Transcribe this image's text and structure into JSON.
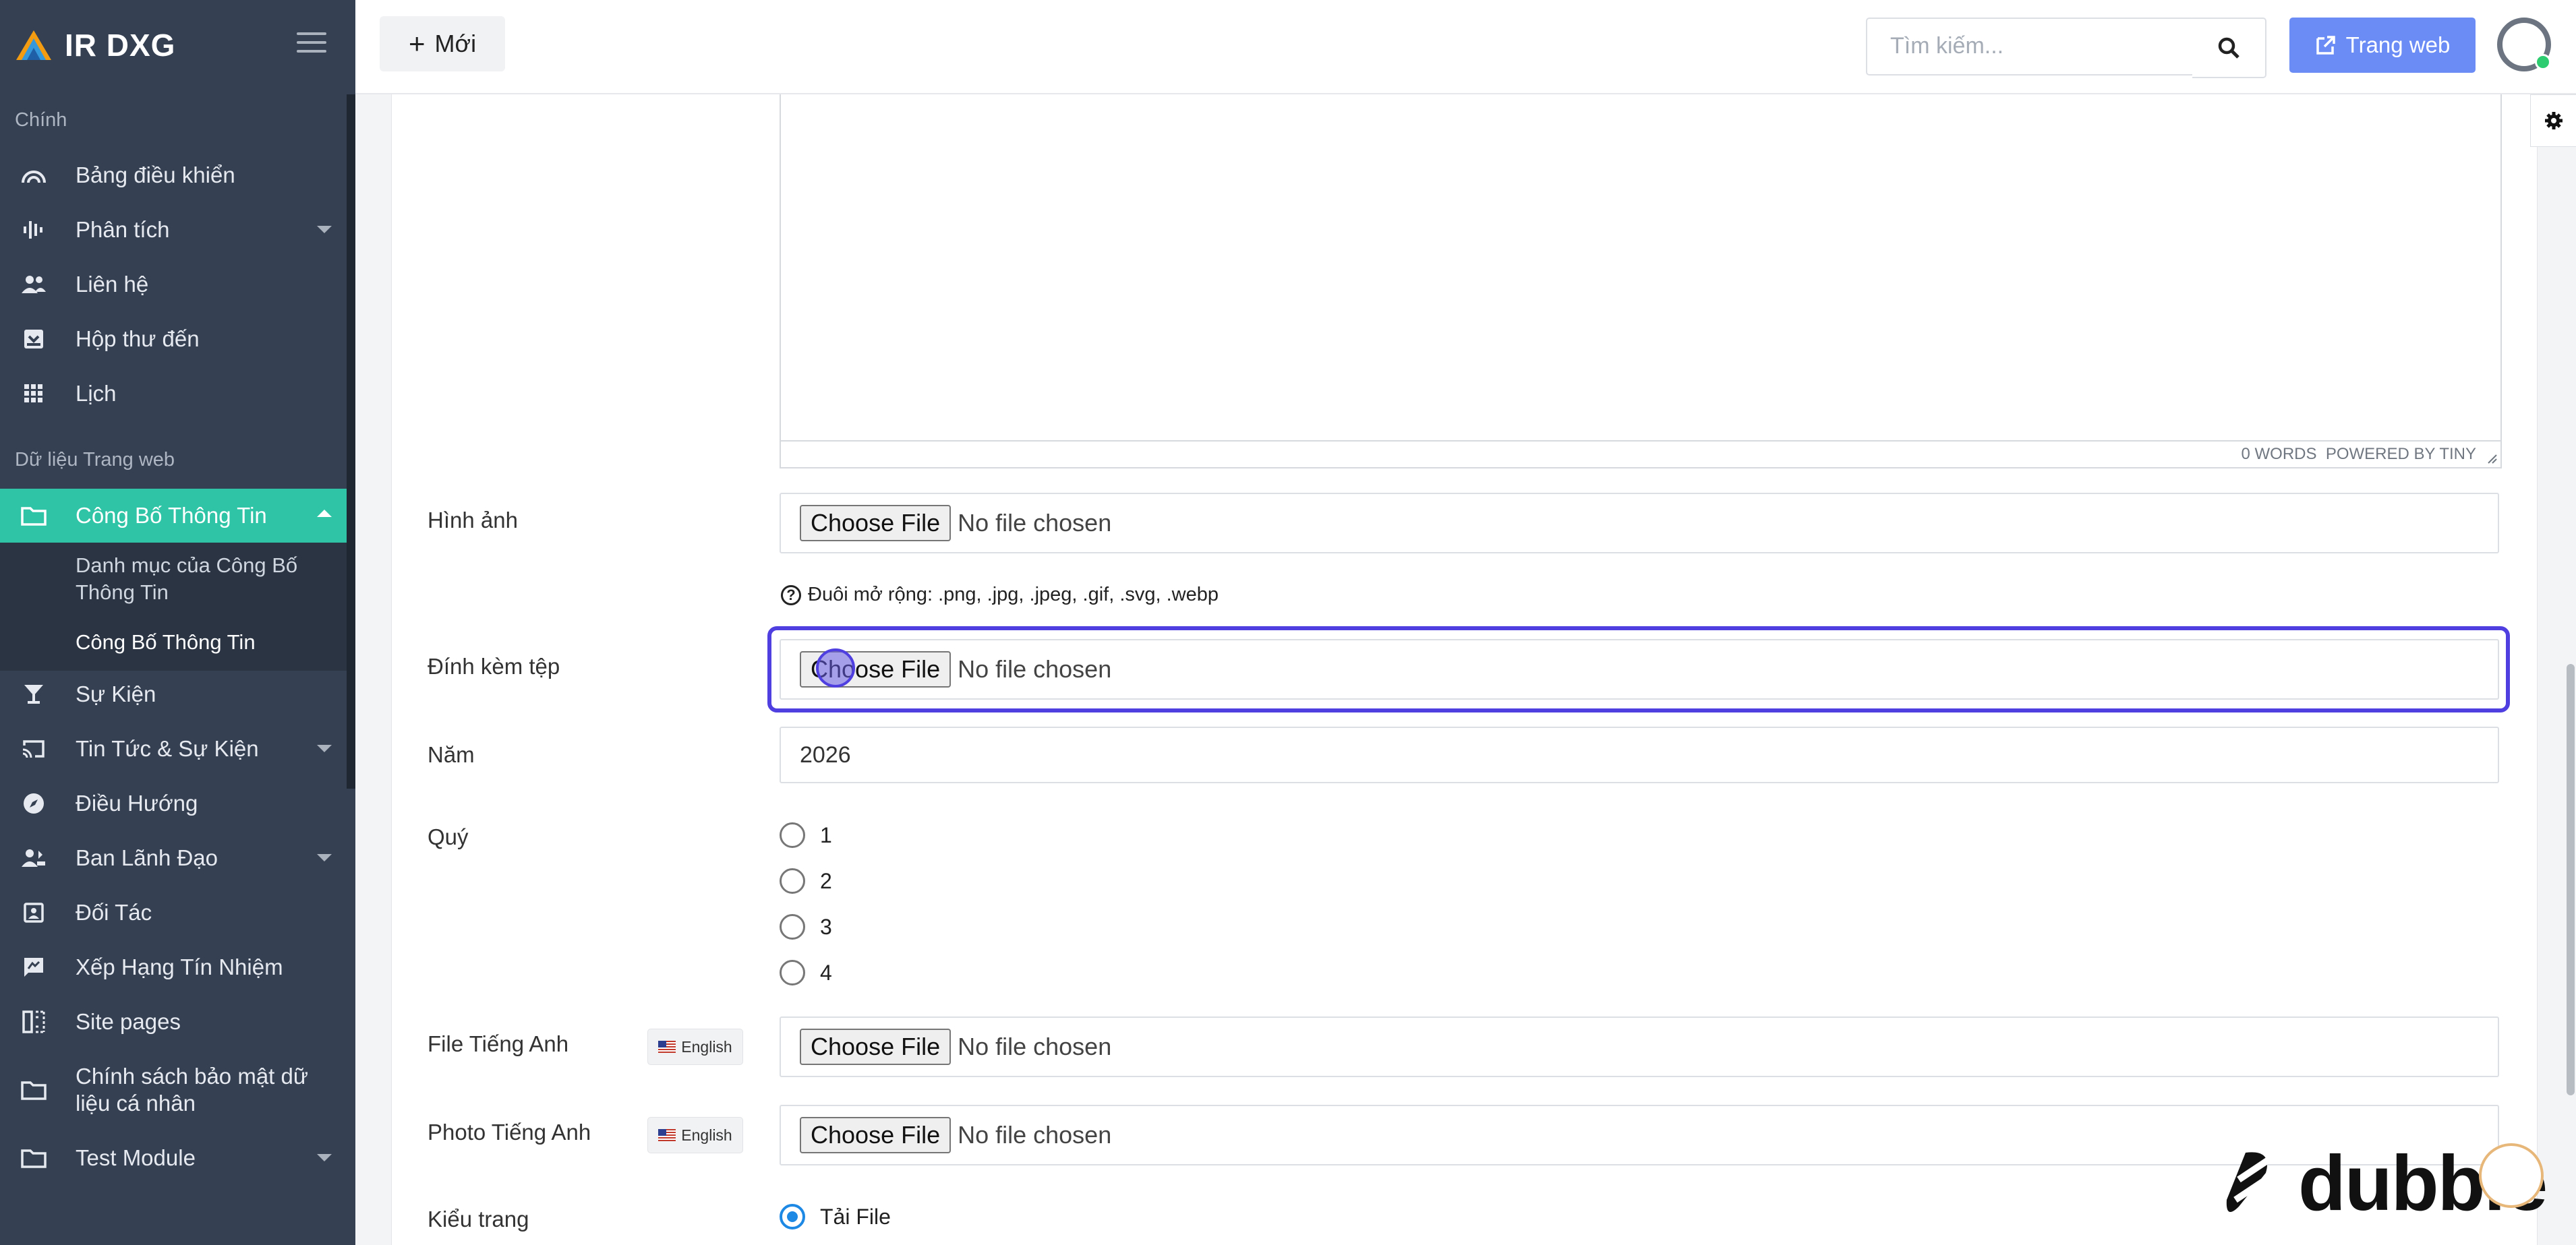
{
  "app": {
    "brand": "IR DXG"
  },
  "sidebar": {
    "section_main": "Chính",
    "section_web": "Dữ liệu Trang web",
    "items": [
      {
        "label": "Bảng điều khiển",
        "icon": "dashboard-icon"
      },
      {
        "label": "Phân tích",
        "icon": "analytics-icon"
      },
      {
        "label": "Liên hệ",
        "icon": "contacts-icon"
      },
      {
        "label": "Hộp thư đến",
        "icon": "inbox-icon"
      },
      {
        "label": "Lịch",
        "icon": "calendar-grid-icon"
      },
      {
        "label": "Công Bố Thông Tin",
        "icon": "folder-icon"
      },
      {
        "label": "Sự Kiện",
        "icon": "glass-icon"
      },
      {
        "label": "Tin Tức & Sự Kiện",
        "icon": "cast-icon"
      },
      {
        "label": "Điều Hướng",
        "icon": "compass-icon"
      },
      {
        "label": "Ban Lãnh Đạo",
        "icon": "people-icon"
      },
      {
        "label": "Đối Tác",
        "icon": "badge-icon"
      },
      {
        "label": "Xếp Hạng Tín Nhiệm",
        "icon": "rating-icon"
      },
      {
        "label": "Site pages",
        "icon": "pages-icon"
      },
      {
        "label": "Chính sách bảo mật dữ liệu cá nhân",
        "icon": "folder-icon"
      },
      {
        "label": "Test Module",
        "icon": "folder-icon"
      }
    ],
    "sub_items": [
      {
        "label": "Danh mục của Công Bố Thông Tin"
      },
      {
        "label": "Công Bố Thông Tin"
      }
    ]
  },
  "topbar": {
    "new_label": "Mới",
    "search_placeholder": "Tìm kiếm...",
    "website_label": "Trang web"
  },
  "editor": {
    "status": "0 WORDS  POWERED BY TINY"
  },
  "form": {
    "image_label": "Hình ảnh",
    "choose_file": "Choose File",
    "no_file": "No file chosen",
    "extensions_hint": "Đuôi mở rộng: .png, .jpg, .jpeg, .gif, .svg, .webp",
    "attachment_label": "Đính kèm tệp",
    "year_label": "Năm",
    "year_value": "2026",
    "quarter_label": "Quý",
    "quarters": [
      "1",
      "2",
      "3",
      "4"
    ],
    "english_file_label": "File Tiếng Anh",
    "english_photo_label": "Photo Tiếng Anh",
    "lang_badge": "English",
    "page_type_label": "Kiểu trang",
    "page_type_option": "Tải File"
  },
  "watermark": {
    "text": "dubble"
  },
  "colors": {
    "sidebar": "#354052",
    "active": "#2ec4a5",
    "accent": "#6b8cf5",
    "focus": "#4f3ee0"
  }
}
